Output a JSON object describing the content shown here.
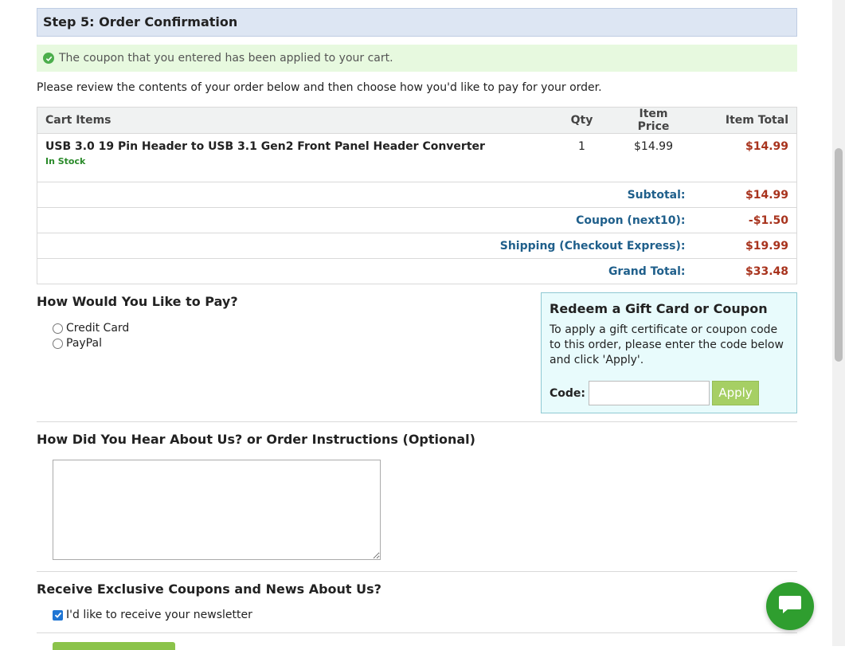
{
  "step_header": "Step 5: Order Confirmation",
  "notice": "The coupon that you entered has been applied to your cart.",
  "intro": "Please review the contents of your order below and then choose how you'd like to pay for your order.",
  "cart": {
    "headers": {
      "item": "Cart Items",
      "qty": "Qty",
      "price": "Item Price",
      "total": "Item Total"
    },
    "items": [
      {
        "name": "USB 3.0 19 Pin Header to USB 3.1 Gen2 Front Panel Header Converter",
        "stock": "In Stock",
        "qty": "1",
        "price": "$14.99",
        "total": "$14.99"
      }
    ],
    "summary": [
      {
        "label": "Subtotal:",
        "value": "$14.99"
      },
      {
        "label": "Coupon (next10):",
        "value": "-$1.50"
      },
      {
        "label": "Shipping (Checkout Express):",
        "value": "$19.99"
      },
      {
        "label": "Grand Total:",
        "value": "$33.48"
      }
    ]
  },
  "payment": {
    "title": "How Would You Like to Pay?",
    "options": [
      "Credit Card",
      "PayPal"
    ]
  },
  "gift": {
    "title": "Redeem a Gift Card or Coupon",
    "text": "To apply a gift certificate or coupon code to this order, please enter the code below and click 'Apply'.",
    "code_label": "Code:",
    "code_value": "",
    "apply_label": "Apply"
  },
  "hear": {
    "title": "How Did You Hear About Us? or Order Instructions (Optional)",
    "value": ""
  },
  "newsletter": {
    "title": "Receive Exclusive Coupons and News About Us?",
    "checkbox_label": "I'd like to receive your newsletter",
    "checked": true
  },
  "icons": {
    "notice": "check-circle-icon",
    "chat": "chat-bubble-icon"
  },
  "colors": {
    "accent_green": "#2f9e2f",
    "price_red": "#a8331d",
    "label_blue": "#1f5f8b"
  }
}
